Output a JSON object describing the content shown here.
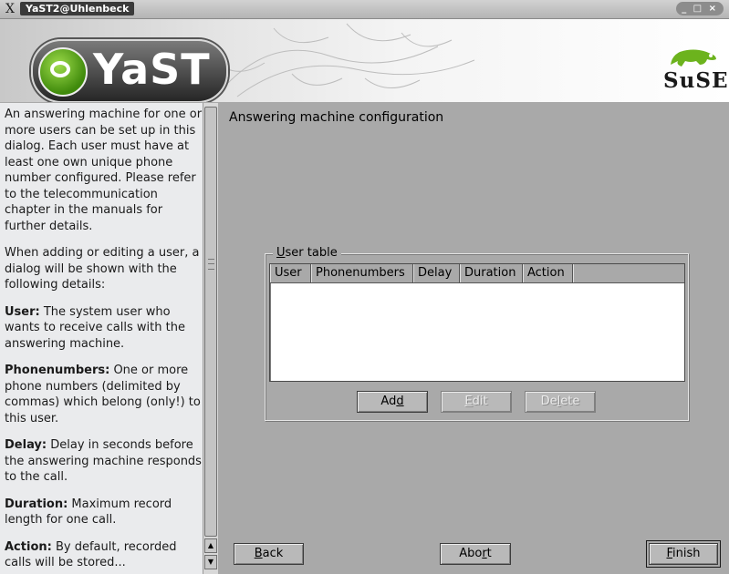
{
  "window": {
    "title": "YaST2@Uhlenbeck",
    "controls": "_ □ ×"
  },
  "banner": {
    "yast_logo": "YaST",
    "suse_logo": "SuSE"
  },
  "help": {
    "paragraphs": [
      {
        "bold": "",
        "text": "An answering machine for one or more users can be set up in this dialog. Each user must have at least one own unique phone number configured. Please refer to the telecommunication chapter in the manuals for further details."
      },
      {
        "bold": "",
        "text": "When adding or editing a user, a dialog will be shown with the following details:"
      },
      {
        "bold": "User:",
        "text": " The system user who wants to receive calls with the answering machine."
      },
      {
        "bold": "Phonenumbers:",
        "text": " One or more phone numbers (delimited by commas) which belong (only!) to this user."
      },
      {
        "bold": "Delay:",
        "text": " Delay in seconds before the answering machine responds to the call."
      },
      {
        "bold": "Duration:",
        "text": " Maximum record length for one call."
      },
      {
        "bold": "Action:",
        "text": " By default, recorded calls will be stored..."
      }
    ]
  },
  "main": {
    "heading": "Answering machine configuration",
    "group_label": "User table",
    "group_label_key": "U",
    "group_label_rest": "ser table",
    "columns": [
      "User",
      "Phonenumbers",
      "Delay",
      "Duration",
      "Action"
    ],
    "rows": [],
    "buttons": {
      "add": {
        "pre": "Ad",
        "key": "d",
        "post": ""
      },
      "edit": {
        "pre": "",
        "key": "E",
        "post": "dit"
      },
      "delete": {
        "pre": "De",
        "key": "l",
        "post": "ete"
      }
    }
  },
  "footer": {
    "back": {
      "pre": "",
      "key": "B",
      "post": "ack"
    },
    "abort": {
      "pre": "Abo",
      "key": "r",
      "post": "t"
    },
    "finish": {
      "pre": "",
      "key": "F",
      "post": "inish"
    }
  },
  "colors": {
    "background": "#a9a9a9",
    "help_background": "#eaebed",
    "table_background": "#ffffff",
    "title_badge": "#3a3a3a"
  }
}
